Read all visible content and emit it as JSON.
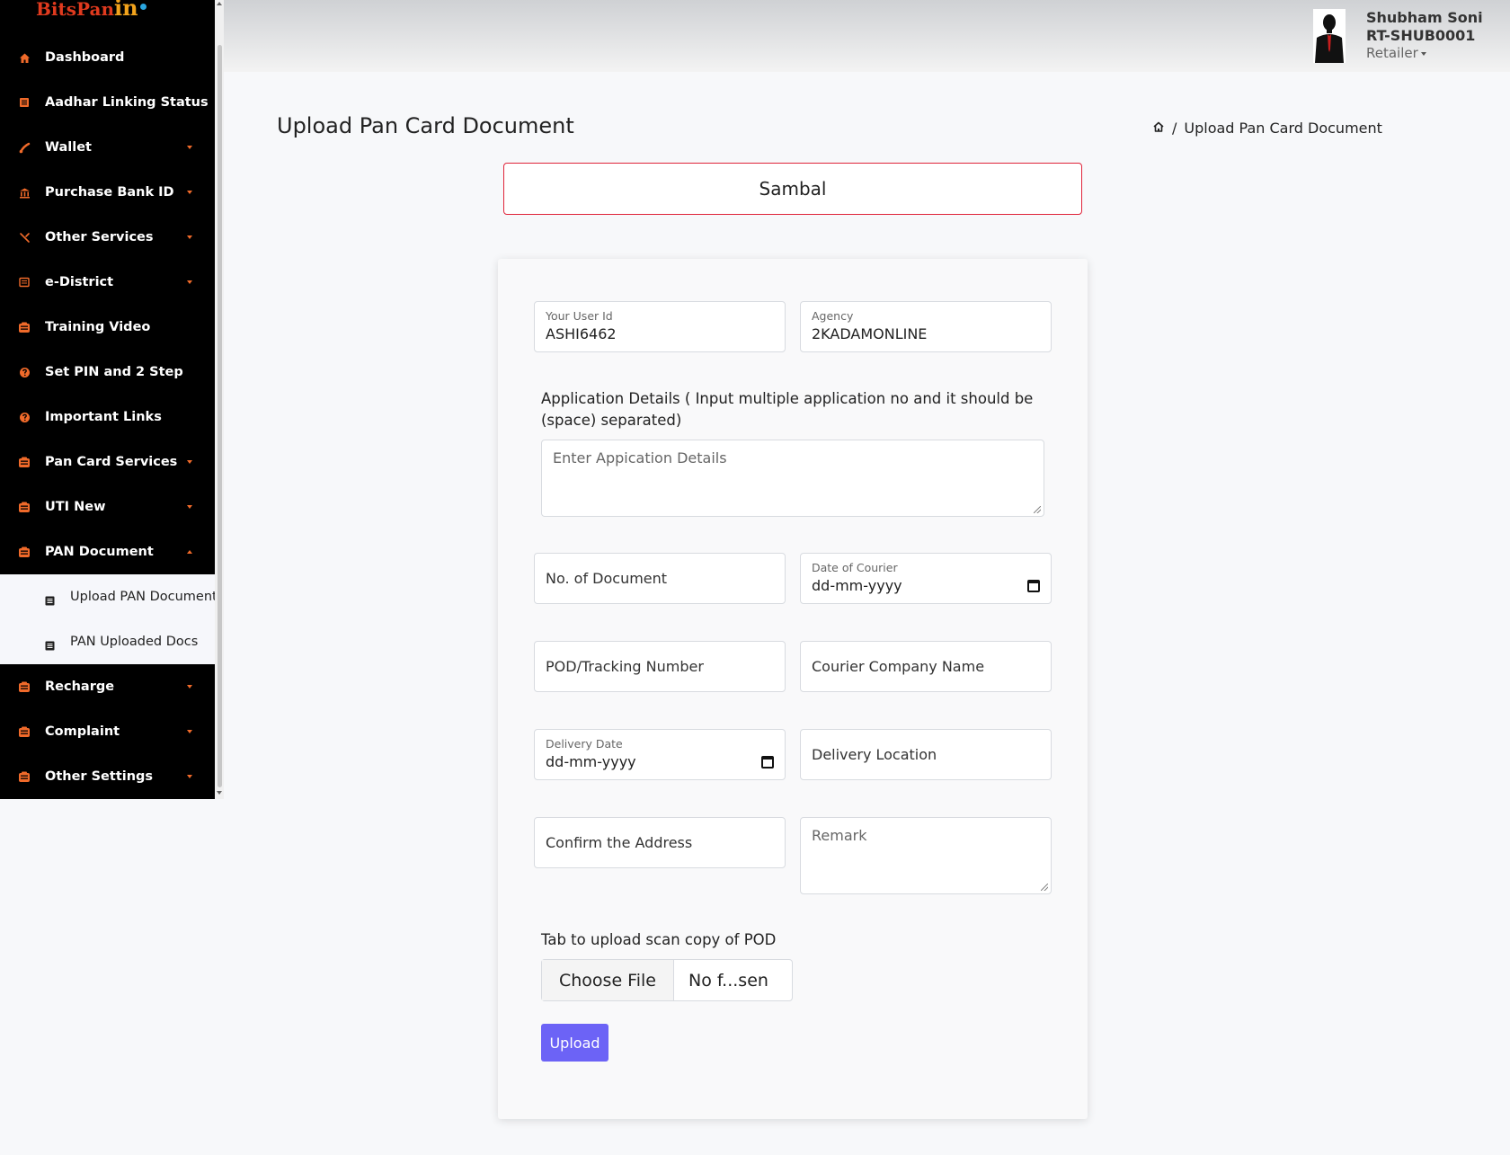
{
  "brand": {
    "logo_text": "BitsPan",
    "logo_suffix": "in"
  },
  "sidebar": {
    "items": [
      {
        "label": "Dashboard",
        "icon": "home-icon",
        "has_caret": false
      },
      {
        "label": "Aadhar Linking Status",
        "icon": "list-icon",
        "has_caret": false
      },
      {
        "label": "Wallet",
        "icon": "wallet-icon",
        "has_caret": true
      },
      {
        "label": "Purchase Bank ID",
        "icon": "bank-icon",
        "has_caret": true
      },
      {
        "label": "Other Services",
        "icon": "tools-icon",
        "has_caret": true
      },
      {
        "label": "e-District",
        "icon": "doc-icon",
        "has_caret": true
      },
      {
        "label": "Training Video",
        "icon": "box-icon",
        "has_caret": false
      },
      {
        "label": "Set PIN and 2 Step",
        "icon": "question-icon",
        "has_caret": false
      },
      {
        "label": "Important Links",
        "icon": "question-icon",
        "has_caret": false
      },
      {
        "label": "Pan Card Services",
        "icon": "box-icon",
        "has_caret": true
      },
      {
        "label": "UTI New",
        "icon": "box-icon",
        "has_caret": true
      },
      {
        "label": "PAN Document",
        "icon": "box-icon",
        "has_caret": true,
        "expanded": true
      }
    ],
    "submenu": [
      {
        "label": "Upload PAN Document",
        "icon": "file-icon"
      },
      {
        "label": "PAN Uploaded Docs",
        "icon": "file-icon"
      }
    ],
    "items_after": [
      {
        "label": "Recharge",
        "icon": "box-icon",
        "has_caret": true
      },
      {
        "label": "Complaint",
        "icon": "box-icon",
        "has_caret": true
      },
      {
        "label": "Other Settings",
        "icon": "box-icon",
        "has_caret": true
      }
    ]
  },
  "user": {
    "name": "Shubham Soni",
    "id": "RT-SHUB0001",
    "role": "Retailer"
  },
  "page": {
    "title": "Upload Pan Card Document",
    "breadcrumb_current": "Upload Pan Card Document"
  },
  "banner": {
    "text": "Sambal"
  },
  "form": {
    "user_id": {
      "label": "Your User Id",
      "value": "ASHI6462"
    },
    "agency": {
      "label": "Agency",
      "value": "2KADAMONLINE"
    },
    "application_details": {
      "label": "Application Details ( Input multiple application no and it should be (space) separated)",
      "placeholder": "Enter Appication Details"
    },
    "no_of_document": {
      "placeholder": "No. of Document"
    },
    "date_of_courier": {
      "label": "Date of Courier",
      "value": "dd-mm-yyyy"
    },
    "pod_tracking": {
      "placeholder": "POD/Tracking Number"
    },
    "courier_company": {
      "placeholder": "Courier Company Name"
    },
    "delivery_date": {
      "label": "Delivery Date",
      "value": "dd-mm-yyyy"
    },
    "delivery_location": {
      "placeholder": "Delivery Location"
    },
    "confirm_address": {
      "placeholder": "Confirm the Address"
    },
    "remark": {
      "placeholder": "Remark"
    },
    "upload_label": "Tab to upload scan copy of POD",
    "file_button": "Choose File",
    "file_name": "No f...sen",
    "upload_button": "Upload"
  },
  "colors": {
    "accent": "#f06a2a",
    "sidebar_bg": "#000000",
    "banner_border": "#e0243a",
    "upload_button": "#6c63f6"
  }
}
